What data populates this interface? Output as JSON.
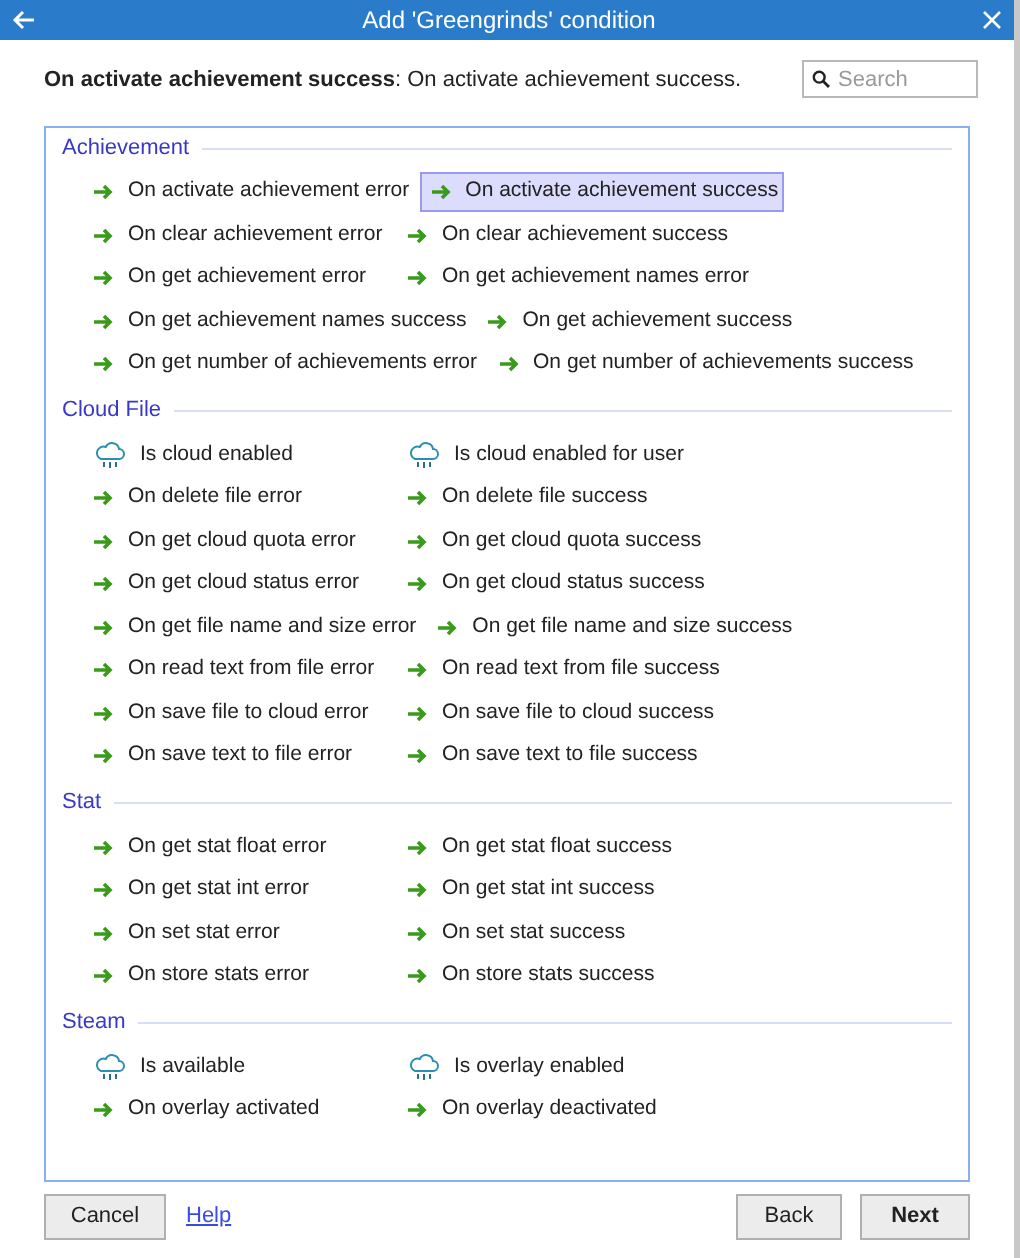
{
  "window": {
    "title": "Add 'Greengrinds' condition"
  },
  "description": {
    "name": "On activate achievement success",
    "text": ": On activate achievement success."
  },
  "search": {
    "placeholder": "Search"
  },
  "sections": [
    {
      "title": "Achievement",
      "items": [
        {
          "label": "On activate achievement error",
          "kind": "event",
          "selected": false
        },
        {
          "label": "On activate achievement success",
          "kind": "event",
          "selected": true
        },
        {
          "label": "On clear achievement error",
          "kind": "event",
          "selected": false
        },
        {
          "label": "On clear achievement success",
          "kind": "event",
          "selected": false
        },
        {
          "label": "On get achievement error",
          "kind": "event",
          "selected": false
        },
        {
          "label": "On get achievement names error",
          "kind": "event",
          "selected": false
        },
        {
          "label": "On get achievement names success",
          "kind": "event",
          "selected": false
        },
        {
          "label": "On get achievement success",
          "kind": "event",
          "selected": false
        },
        {
          "label": "On get number of achievements error",
          "kind": "event",
          "selected": false
        },
        {
          "label": "On get number of achievements success",
          "kind": "event",
          "selected": false
        }
      ]
    },
    {
      "title": "Cloud File",
      "items": [
        {
          "label": "Is cloud enabled",
          "kind": "condition",
          "selected": false
        },
        {
          "label": "Is cloud enabled for user",
          "kind": "condition",
          "selected": false
        },
        {
          "label": "On delete file error",
          "kind": "event",
          "selected": false
        },
        {
          "label": "On delete file success",
          "kind": "event",
          "selected": false
        },
        {
          "label": "On get cloud quota error",
          "kind": "event",
          "selected": false
        },
        {
          "label": "On get cloud quota success",
          "kind": "event",
          "selected": false
        },
        {
          "label": "On get cloud status error",
          "kind": "event",
          "selected": false
        },
        {
          "label": "On get cloud status success",
          "kind": "event",
          "selected": false
        },
        {
          "label": "On get file name and size error",
          "kind": "event",
          "selected": false
        },
        {
          "label": "On get file name and size success",
          "kind": "event",
          "selected": false
        },
        {
          "label": "On read text from file error",
          "kind": "event",
          "selected": false
        },
        {
          "label": "On read text from file success",
          "kind": "event",
          "selected": false
        },
        {
          "label": "On save file to cloud error",
          "kind": "event",
          "selected": false
        },
        {
          "label": "On save file to cloud success",
          "kind": "event",
          "selected": false
        },
        {
          "label": "On save text to file error",
          "kind": "event",
          "selected": false
        },
        {
          "label": "On save text to file success",
          "kind": "event",
          "selected": false
        }
      ]
    },
    {
      "title": "Stat",
      "items": [
        {
          "label": "On get stat float error",
          "kind": "event",
          "selected": false
        },
        {
          "label": "On get stat float success",
          "kind": "event",
          "selected": false
        },
        {
          "label": "On get stat int error",
          "kind": "event",
          "selected": false
        },
        {
          "label": "On get stat int success",
          "kind": "event",
          "selected": false
        },
        {
          "label": "On set stat error",
          "kind": "event",
          "selected": false
        },
        {
          "label": "On set stat success",
          "kind": "event",
          "selected": false
        },
        {
          "label": "On store stats error",
          "kind": "event",
          "selected": false
        },
        {
          "label": "On store stats success",
          "kind": "event",
          "selected": false
        }
      ]
    },
    {
      "title": "Steam",
      "items": [
        {
          "label": "Is available",
          "kind": "condition",
          "selected": false
        },
        {
          "label": "Is overlay enabled",
          "kind": "condition",
          "selected": false
        },
        {
          "label": "On overlay activated",
          "kind": "event",
          "selected": false
        },
        {
          "label": "On overlay deactivated",
          "kind": "event",
          "selected": false
        }
      ]
    }
  ],
  "footer": {
    "cancel": "Cancel",
    "help": "Help",
    "back": "Back",
    "next": "Next"
  }
}
